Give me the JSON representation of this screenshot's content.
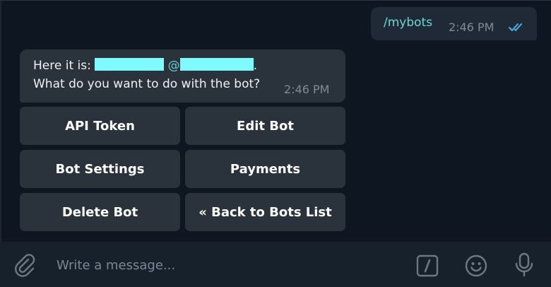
{
  "outgoing_message": {
    "text": "/mybots",
    "time": "2:46 PM",
    "status_icon": "double-check-icon"
  },
  "incoming_message": {
    "prefix": "Here it is: ",
    "at": "@",
    "suffix": ".",
    "line2": "What do you want to do with the bot?",
    "time": "2:46 PM"
  },
  "keyboard": {
    "buttons": [
      {
        "label": "API Token"
      },
      {
        "label": "Edit Bot"
      },
      {
        "label": "Bot Settings"
      },
      {
        "label": "Payments"
      },
      {
        "label": "Delete Bot"
      },
      {
        "label": "« Back to Bots List"
      }
    ]
  },
  "composer": {
    "placeholder": "Write a message...",
    "icons": [
      "paperclip-icon",
      "slash-command-icon",
      "emoji-icon",
      "microphone-icon"
    ]
  },
  "colors": {
    "background": "#0e1621",
    "bubble": "#2a323c",
    "accent_text": "#6ad8d2",
    "redaction": "#7ffbff",
    "check": "#4fb3e8"
  }
}
